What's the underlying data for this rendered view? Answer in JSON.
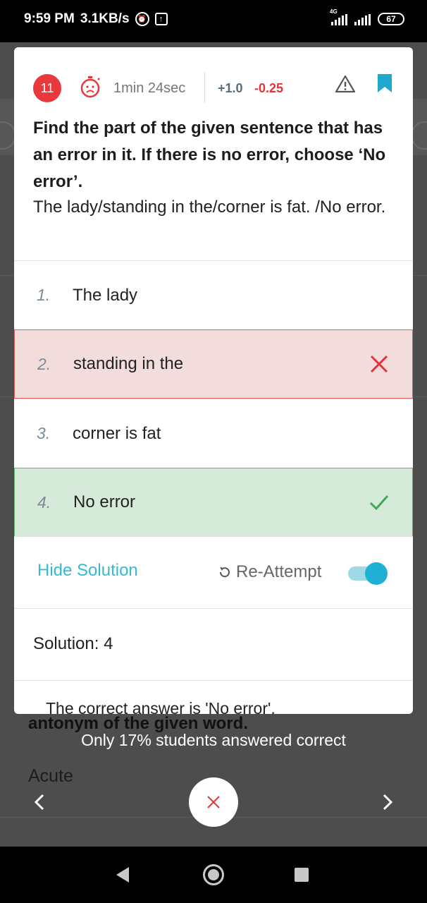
{
  "status_bar": {
    "time": "9:59 PM",
    "speed": "3.1KB/s",
    "network_tag": "4G",
    "battery": "67"
  },
  "question": {
    "number": "11",
    "timer": "1min 24sec",
    "marks_correct": "+1.0",
    "marks_wrong": "-0.25",
    "instruction": "Find the part of the given sentence that has an error in it. If there is no error, choose ‘No error’.",
    "sentence": "The lady/standing in the/corner is fat. /No error."
  },
  "options": [
    {
      "num": "1.",
      "text": "The lady",
      "state": "normal"
    },
    {
      "num": "2.",
      "text": "standing in the",
      "state": "wrong"
    },
    {
      "num": "3.",
      "text": "corner is fat",
      "state": "normal"
    },
    {
      "num": "4.",
      "text": "No error",
      "state": "correct"
    }
  ],
  "solution_bar": {
    "hide_label": "Hide Solution",
    "reattempt_label": "Re-Attempt",
    "toggle_on": true
  },
  "solution": {
    "title": "Solution: 4",
    "body_clipped": "The correct answer is 'No error'."
  },
  "background": {
    "partial_text": "antonym of the given word.",
    "word": "Acute"
  },
  "stats_text": "Only 17% students answered correct",
  "colors": {
    "accent": "#37b8d0",
    "wrong": "#e2343a",
    "correct": "#5cb96a"
  }
}
